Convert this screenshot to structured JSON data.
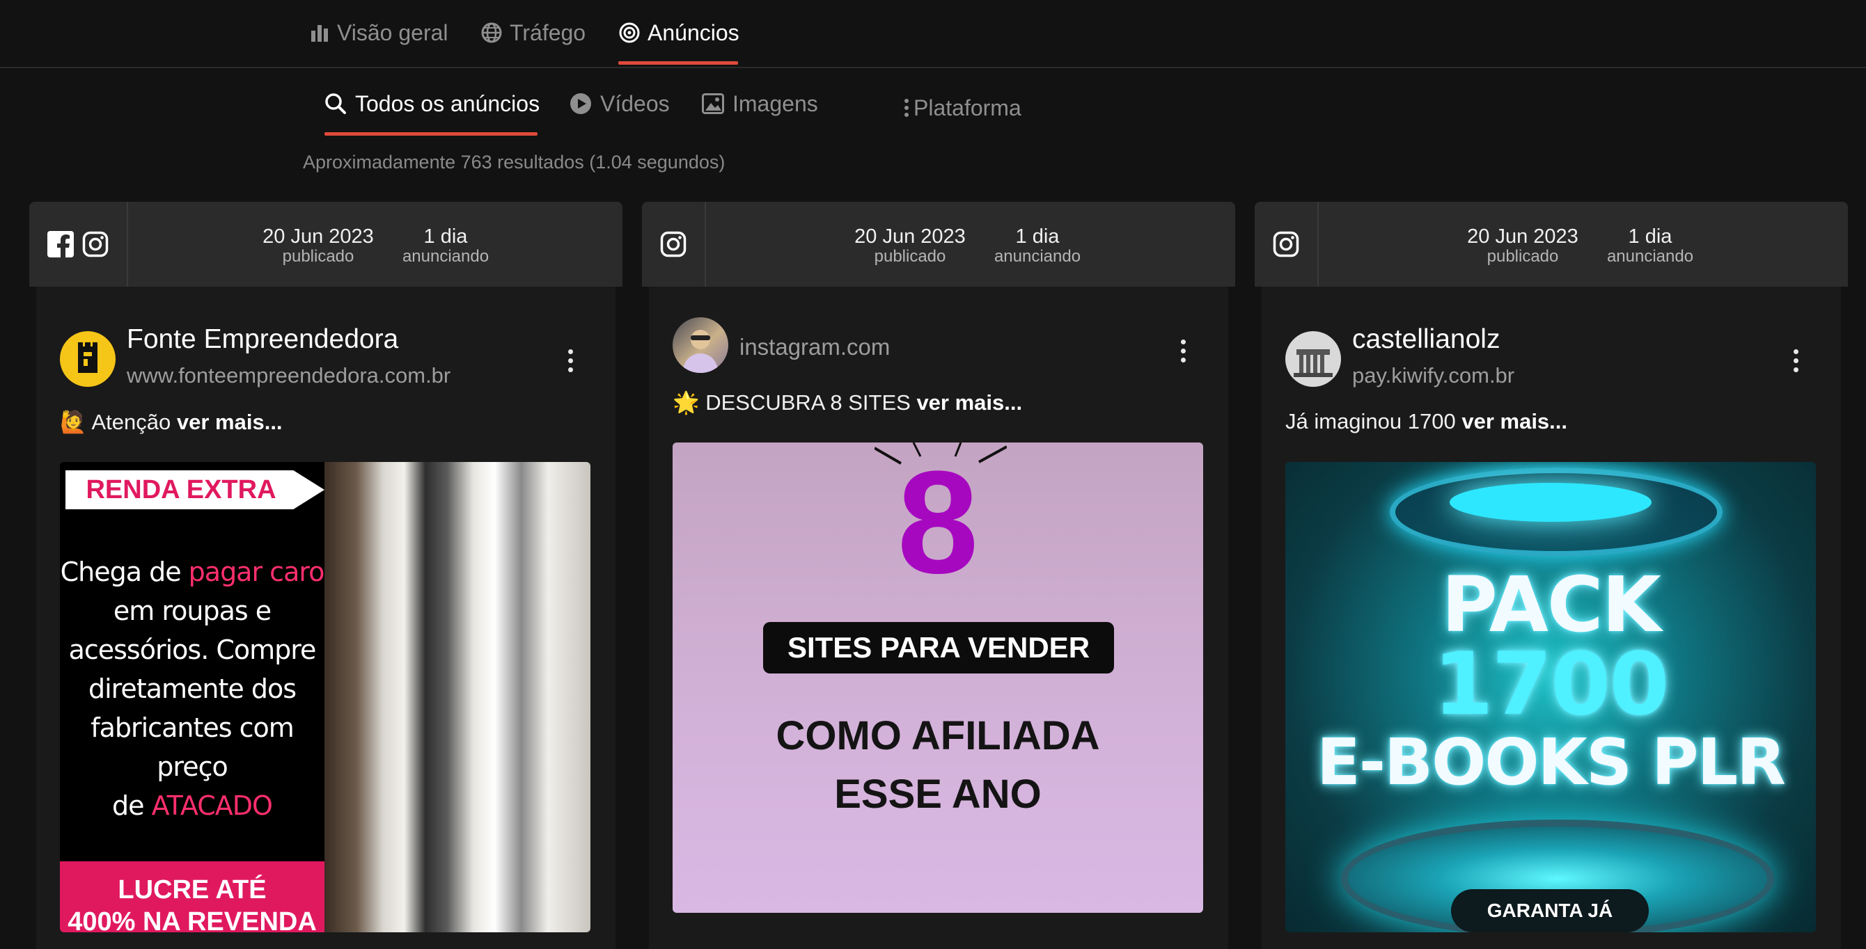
{
  "topnav": {
    "items": [
      {
        "label": "Visão geral",
        "icon": "bar-chart-icon"
      },
      {
        "label": "Tráfego",
        "icon": "globe-icon"
      },
      {
        "label": "Anúncios",
        "icon": "target-icon",
        "active": true
      }
    ]
  },
  "subtabs": {
    "items": [
      {
        "label": "Todos os anúncios",
        "icon": "search-icon",
        "active": true
      },
      {
        "label": "Vídeos",
        "icon": "play-circle-icon"
      },
      {
        "label": "Imagens",
        "icon": "image-icon"
      },
      {
        "label": "Plataforma",
        "icon": "more-vertical-icon"
      }
    ]
  },
  "results_text": "Aproximadamente 763 resultados (1.04 segundos)",
  "accent_color": "#e04a3b",
  "cards": [
    {
      "platforms": [
        "facebook-icon",
        "instagram-icon"
      ],
      "date": "20 Jun 2023",
      "date_label": "publicado",
      "duration": "1 dia",
      "duration_label": "anunciando",
      "author": "Fonte Empreendedora",
      "domain": "www.fonteempreendedora.com.br",
      "caption_text": "🙋 Atenção",
      "more": "ver mais...",
      "creative": {
        "flag": "RENDA EXTRA",
        "line1a": "Chega de ",
        "line1b": "pagar caro",
        "line2": "em roupas e",
        "line3": "acessórios. Compre",
        "line4": "diretamente dos",
        "line5": "fabricantes com preço",
        "line6a": "de ",
        "line6b": "ATACADO",
        "banner1": "LUCRE ATÉ",
        "banner2": "400% NA REVENDA"
      }
    },
    {
      "platforms": [
        "instagram-icon"
      ],
      "date": "20 Jun 2023",
      "date_label": "publicado",
      "duration": "1 dia",
      "duration_label": "anunciando",
      "author": "",
      "domain": "instagram.com",
      "caption_text": "🌟 DESCUBRA 8 SITES",
      "more": "ver mais...",
      "creative": {
        "number": "8",
        "pill": "SITES PARA VENDER",
        "line1": "COMO AFILIADA",
        "line2": "ESSE ANO"
      }
    },
    {
      "platforms": [
        "instagram-icon"
      ],
      "date": "20 Jun 2023",
      "date_label": "publicado",
      "duration": "1 dia",
      "duration_label": "anunciando",
      "author": "castellianolz",
      "domain": "pay.kiwify.com.br",
      "caption_text": "Já imaginou 1700",
      "more": "ver mais...",
      "creative": {
        "line1": "PACK",
        "line2": "1700",
        "line3": "E-BOOKS PLR",
        "button": "GARANTA JÁ"
      }
    }
  ]
}
